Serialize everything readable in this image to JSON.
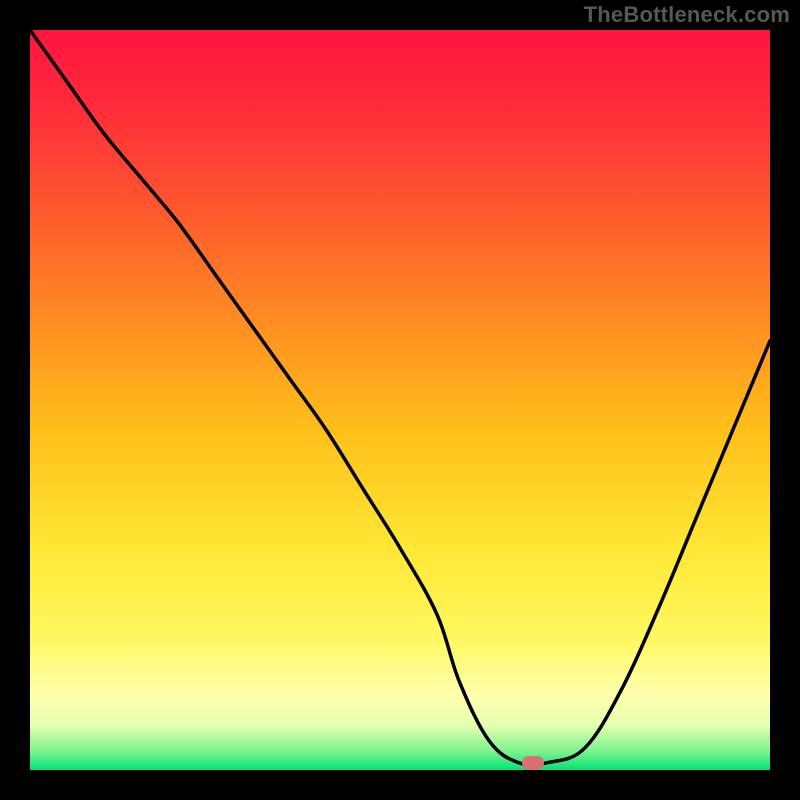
{
  "watermark": "TheBottleneck.com",
  "colors": {
    "frame": "#000000",
    "watermark": "#575757",
    "line": "#000000",
    "marker": "#db6e6e",
    "gradient_stops": [
      {
        "offset": 0.0,
        "color": "#ff143f"
      },
      {
        "offset": 0.1,
        "color": "#ff2a3a"
      },
      {
        "offset": 0.25,
        "color": "#ff5a2d"
      },
      {
        "offset": 0.4,
        "color": "#ff8f21"
      },
      {
        "offset": 0.55,
        "color": "#ffc21a"
      },
      {
        "offset": 0.7,
        "color": "#ffe733"
      },
      {
        "offset": 0.82,
        "color": "#fff85f"
      },
      {
        "offset": 0.9,
        "color": "#ffffad"
      },
      {
        "offset": 0.94,
        "color": "#e3ffb0"
      },
      {
        "offset": 0.975,
        "color": "#7df38e"
      },
      {
        "offset": 1.0,
        "color": "#00e277"
      }
    ]
  },
  "chart_data": {
    "type": "line",
    "title": "",
    "xlabel": "",
    "ylabel": "",
    "xlim": [
      0,
      100
    ],
    "ylim": [
      0,
      100
    ],
    "grid": false,
    "legend": false,
    "x": [
      0,
      5,
      10,
      15,
      20,
      25,
      30,
      35,
      40,
      45,
      50,
      55,
      58,
      62,
      66,
      70,
      75,
      80,
      85,
      90,
      95,
      100
    ],
    "values": [
      100,
      93,
      86,
      80,
      74,
      67,
      60,
      53,
      46,
      38,
      30,
      21,
      12,
      4,
      1,
      1,
      3,
      11,
      22,
      34,
      46,
      58
    ],
    "marker": {
      "x": 68,
      "y": 1
    },
    "annotations": []
  }
}
